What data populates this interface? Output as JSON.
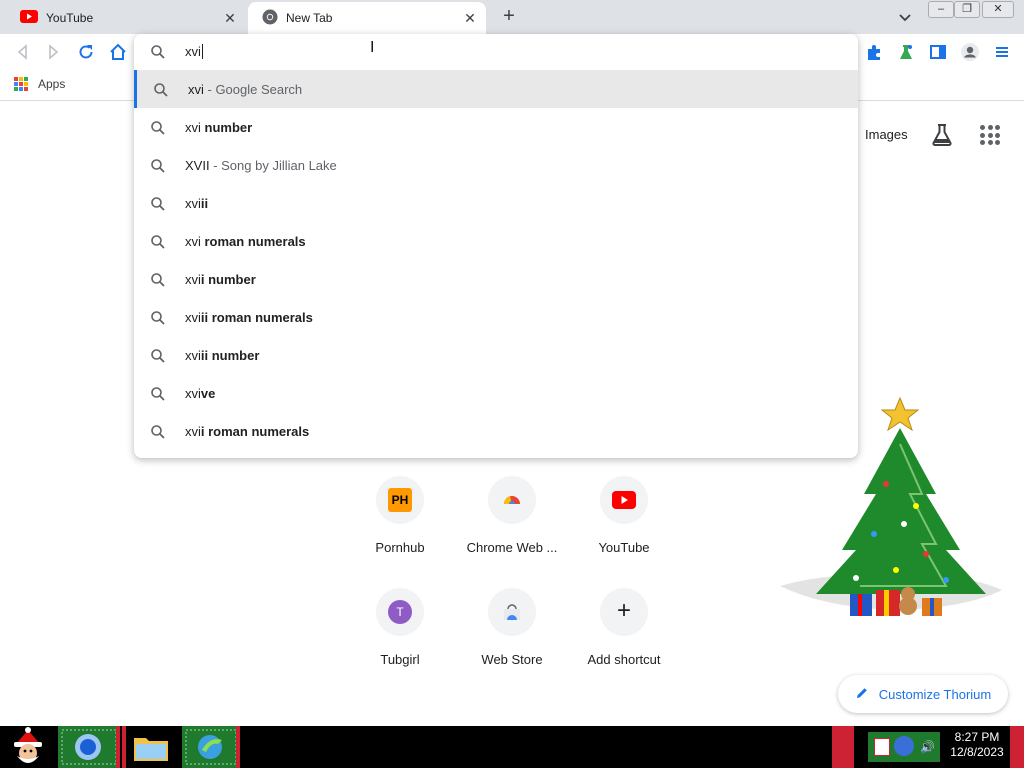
{
  "tabs": [
    {
      "title": "YouTube"
    },
    {
      "title": "New Tab"
    }
  ],
  "window": {
    "minimize": "‒",
    "maximize": "❐",
    "close": "✕"
  },
  "bookmarks": {
    "apps_label": "Apps"
  },
  "omnibox": {
    "value": "xvi",
    "suggestions": [
      {
        "normal": "xvi",
        "bold": "",
        "suffix": " - Google Search"
      },
      {
        "normal": "xvi ",
        "bold": "number",
        "suffix": ""
      },
      {
        "normal": "XVII",
        "bold": "",
        "suffix": " - Song by Jillian Lake"
      },
      {
        "normal": "xvi",
        "bold": "ii",
        "suffix": ""
      },
      {
        "normal": "xvi ",
        "bold": "roman numerals",
        "suffix": ""
      },
      {
        "normal": "xvi",
        "bold": "i number",
        "suffix": ""
      },
      {
        "normal": "xvi",
        "bold": "ii roman numerals",
        "suffix": ""
      },
      {
        "normal": "xvi",
        "bold": "ii number",
        "suffix": ""
      },
      {
        "normal": "xvi",
        "bold": "ve",
        "suffix": ""
      },
      {
        "normal": "xvi",
        "bold": "i roman numerals",
        "suffix": ""
      }
    ]
  },
  "ntp": {
    "images_link": "Images",
    "shortcuts": [
      {
        "name": "Pornhub",
        "icon_text": "PH"
      },
      {
        "name": "Chrome Web ...",
        "icon_text": ""
      },
      {
        "name": "YouTube",
        "icon_text": ""
      },
      {
        "name": "Tubgirl",
        "icon_text": "T"
      },
      {
        "name": "Web Store",
        "icon_text": ""
      },
      {
        "name": "Add shortcut",
        "icon_text": "+"
      }
    ],
    "customize_label": "Customize Thorium"
  },
  "taskbar": {
    "time": "8:27 PM",
    "date": "12/8/2023"
  },
  "colors": {
    "accent": "#1a73e8",
    "youtube_red": "#ff0000",
    "ph_orange": "#ff9900",
    "tubgirl_purple": "#8e5cc4"
  }
}
